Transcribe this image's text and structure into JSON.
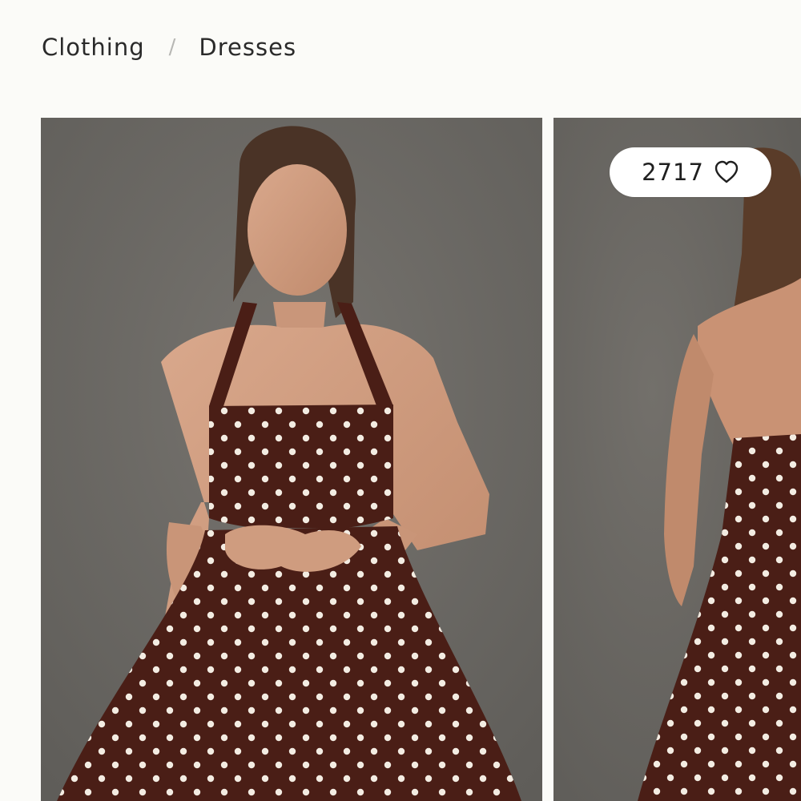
{
  "breadcrumb": {
    "items": [
      {
        "label": "Clothing"
      },
      {
        "label": "Dresses"
      }
    ],
    "separator": "/"
  },
  "gallery": {
    "images": [
      {
        "alt": "front-view"
      },
      {
        "alt": "back-view"
      }
    ]
  },
  "likes": {
    "count": "2717",
    "icon": "heart-outline-icon"
  },
  "colors": {
    "background": "#fbfbf8",
    "studio_backdrop": "#6b6965",
    "dress": "#4a1e16",
    "polka_dot": "#f3ece2",
    "text": "#2a2a2a"
  }
}
